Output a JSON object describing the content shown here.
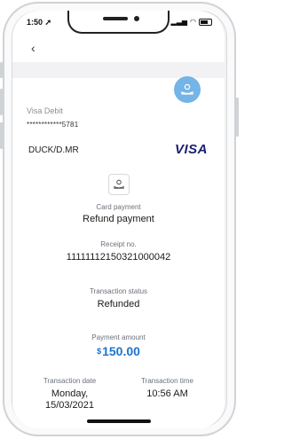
{
  "status_bar": {
    "time": "1:50"
  },
  "nav": {
    "back_glyph": "‹"
  },
  "card": {
    "type": "Visa Debit",
    "number": "************5781",
    "holder": "DUCK/D.MR",
    "brand": "VISA"
  },
  "payment": {
    "category": "Card payment",
    "type": "Refund payment"
  },
  "receipt": {
    "label": "Receipt no.",
    "value": "11111112150321000042"
  },
  "status": {
    "label": "Transaction status",
    "value": "Refunded"
  },
  "amount": {
    "label": "Payment amount",
    "currency": "$",
    "value": "150.00"
  },
  "date": {
    "label": "Transaction date",
    "value_line1": "Monday,",
    "value_line2": "15/03/2021"
  },
  "time": {
    "label": "Transaction time",
    "value": "10:56 AM"
  },
  "colors": {
    "accent": "#1d74d0",
    "avatar": "#74b4e6",
    "visa": "#1a1f71"
  }
}
